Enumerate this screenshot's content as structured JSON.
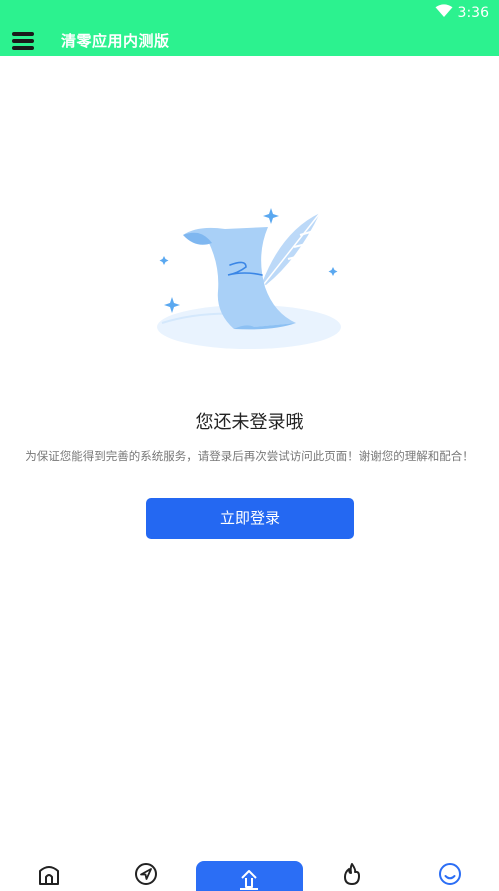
{
  "status_bar": {
    "time": "3:36",
    "icons": [
      "wifi-icon"
    ]
  },
  "header": {
    "title": "清零应用内测版",
    "menu_icon": "menu-icon"
  },
  "empty_state": {
    "title": "您还未登录哦",
    "description": "为保证您能得到完善的系统服务，请登录后再次尝试访问此页面！谢谢您的理解和配合！",
    "button_label": "立即登录"
  },
  "tabbar": {
    "items": [
      {
        "icon": "home-icon"
      },
      {
        "icon": "navigation-icon"
      },
      {
        "icon": "upload-icon"
      },
      {
        "icon": "fire-icon"
      },
      {
        "icon": "smile-icon",
        "active": true
      }
    ]
  },
  "colors": {
    "header_bg": "#2cf28f",
    "accent": "#2468f2",
    "active_tab": "#2b6ef5"
  }
}
